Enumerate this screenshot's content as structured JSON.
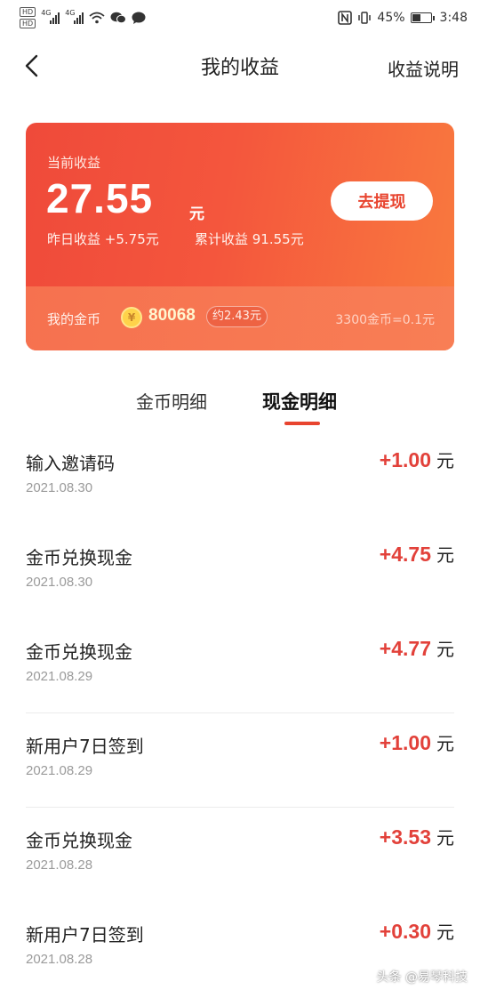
{
  "status_bar": {
    "hd1": "HD",
    "hd2": "HD",
    "net1": "4G",
    "net2": "4G",
    "battery_pct": "45%",
    "time": "3:48",
    "battery_level": 0.45,
    "icons": [
      "hd-icon",
      "signal-icon",
      "wifi-icon",
      "wechat-icon",
      "chat-icon",
      "nfc-icon",
      "vibrate-icon",
      "battery-icon"
    ]
  },
  "header": {
    "title": "我的收益",
    "link": "收益说明"
  },
  "card": {
    "current_label": "当前收益",
    "amount": "27.55",
    "unit": "元",
    "yesterday": "昨日收益 +5.75元",
    "total": "累计收益 91.55元",
    "withdraw_label": "去提现",
    "coin_label": "我的金币",
    "coin_icon_glyph": "¥",
    "coin_amount": "80068",
    "coin_approx": "约2.43元",
    "coin_rate": "3300金币=0.1元",
    "colors": {
      "accent": "#e8442f",
      "card_start": "#ef4a3a",
      "card_end": "#f97a3e"
    }
  },
  "tabs": [
    {
      "label": "金币明细",
      "active": false
    },
    {
      "label": "现金明细",
      "active": true
    }
  ],
  "records": [
    {
      "title": "输入邀请码",
      "date": "2021.08.30",
      "amount": "+1.00",
      "unit": "元"
    },
    {
      "title": "金币兑换现金",
      "date": "2021.08.30",
      "amount": "+4.75",
      "unit": "元"
    },
    {
      "title": "金币兑换现金",
      "date": "2021.08.29",
      "amount": "+4.77",
      "unit": "元"
    },
    {
      "title": "新用户7日签到",
      "date": "2021.08.29",
      "amount": "+1.00",
      "unit": "元"
    },
    {
      "title": "金币兑换现金",
      "date": "2021.08.28",
      "amount": "+3.53",
      "unit": "元"
    },
    {
      "title": "新用户7日签到",
      "date": "2021.08.28",
      "amount": "+0.30",
      "unit": "元"
    }
  ],
  "watermark": "头条 @易琴科技"
}
